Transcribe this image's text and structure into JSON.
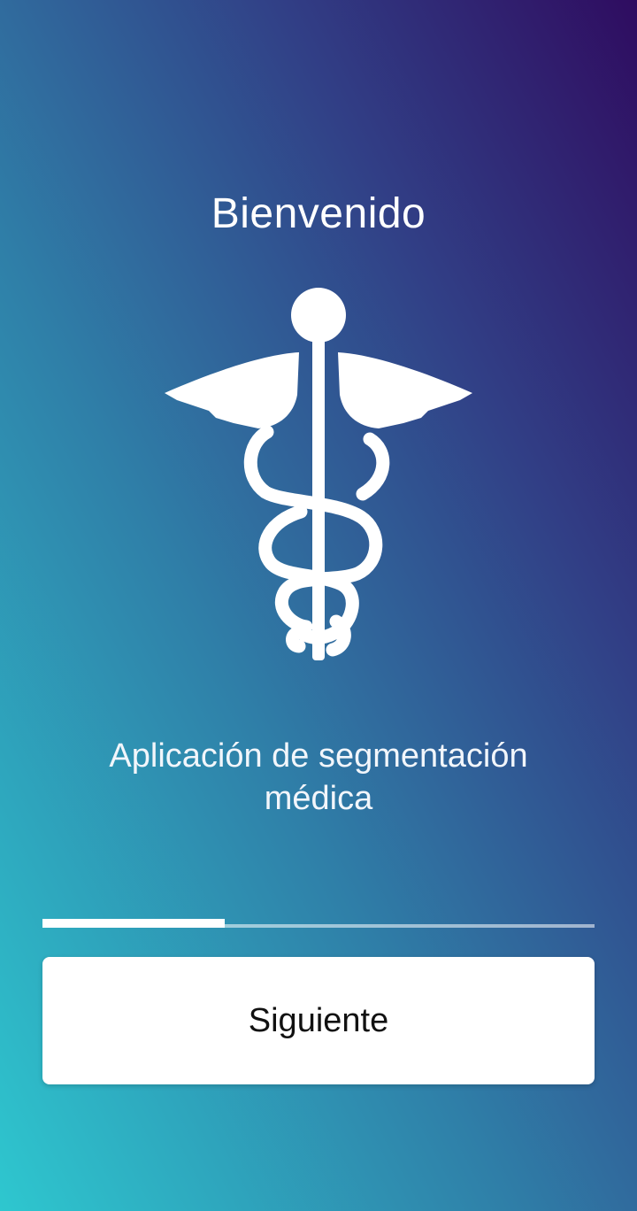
{
  "welcome": {
    "title": "Bienvenido",
    "logo_icon": "caduceus-icon",
    "subtitle": "Aplicación de segmentación médica"
  },
  "onboarding": {
    "progress_fraction": 0.33
  },
  "actions": {
    "next_label": "Siguiente"
  },
  "theme": {
    "gradient_start": "#2ec7cf",
    "gradient_mid": "#313f86",
    "gradient_end": "#2f0c60",
    "button_bg": "#ffffff",
    "button_text": "#111111"
  }
}
